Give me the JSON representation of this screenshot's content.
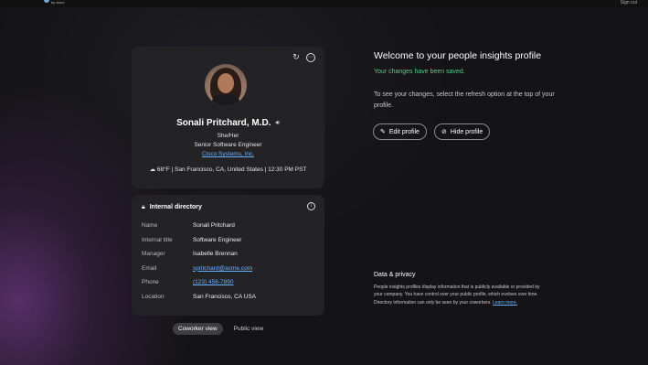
{
  "header": {
    "brand_sub": "by cisco",
    "top_right": "Sign out"
  },
  "profile": {
    "name": "Sonali Pritchard, M.D.",
    "pronouns": "She/Her",
    "job_title": "Senior Software Engineer",
    "company": "Cisco Systems, Inc.",
    "weather_location_time": "68°F | San Francisco, CA, United States | 12:30 PM PST",
    "icons": {
      "refresh": "refresh-icon",
      "more": "more-options-icon",
      "audio": "audio-pronunciation-icon",
      "weather": "cloud-weather-icon"
    }
  },
  "directory": {
    "title": "Internal directory",
    "rows": [
      {
        "label": "Name",
        "value": "Sonali Pritchard"
      },
      {
        "label": "Internal title",
        "value": "Software Engineer"
      },
      {
        "label": "Manager",
        "value": "Isabelle Brennan"
      },
      {
        "label": "Email",
        "value": "spritchard@acme.com"
      },
      {
        "label": "Phone",
        "value": "(123) 456-7890"
      },
      {
        "label": "Location",
        "value": "San Francisco, CA USA"
      }
    ]
  },
  "views": {
    "coworker": "Coworker view",
    "public": "Public view",
    "selected": "Coworker view"
  },
  "welcome": {
    "title": "Welcome to your people insights profile",
    "saved": "Your changes have been saved.",
    "instructions": "To see your changes, select the refresh option at the top of your profile.",
    "edit_label": "Edit profile",
    "hide_label": "Hide profile"
  },
  "privacy": {
    "title": "Data & privacy",
    "text": "People insights profiles display information that is publicly available or provided by your company. You have control over your public profile, which evolves over time. Directory information can only be seen by your coworkers.",
    "link": "Learn more."
  },
  "colors": {
    "background": "#141416",
    "card": "#232326",
    "link": "#6ab2ff",
    "success": "#54c98a",
    "accent_glow": "#6e3782"
  }
}
